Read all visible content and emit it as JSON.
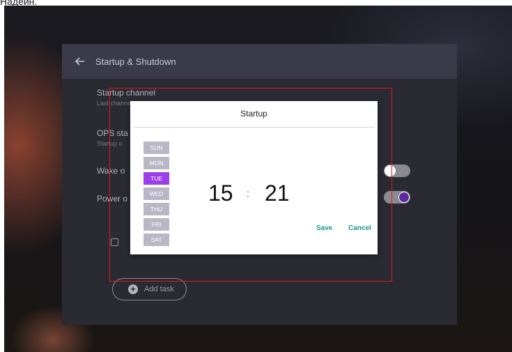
{
  "caption": "Надеин.",
  "header": {
    "title": "Startup & Shutdown"
  },
  "settings": {
    "startup_channel": {
      "label": "Startup channel",
      "sub": "Last channel"
    },
    "ops_startup": {
      "label": "OPS sta",
      "sub": "Startup o"
    },
    "wake_on": {
      "label": "Wake o"
    },
    "power_on": {
      "label": "Power o"
    }
  },
  "add_task_label": "Add task",
  "dialog": {
    "title": "Startup",
    "days": [
      "SUN",
      "MON",
      "TUE",
      "WED",
      "THU",
      "FRI",
      "SAT"
    ],
    "selected_day": "TUE",
    "hour": "15",
    "separator": ":",
    "minute": "21",
    "save_label": "Save",
    "cancel_label": "Cancel"
  },
  "colors": {
    "accent": "#9b3de8",
    "action": "#18998a",
    "highlight": "#e01616"
  }
}
